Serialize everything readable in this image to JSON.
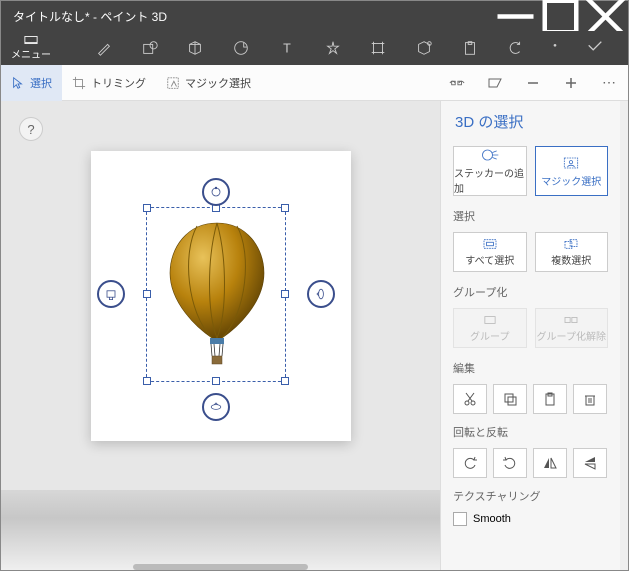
{
  "window": {
    "title": "タイトルなし* - ペイント 3D"
  },
  "menu": {
    "label": "メニュー"
  },
  "toolbar2": {
    "select": "選択",
    "trimming": "トリミング",
    "magicSelect": "マジック選択",
    "more": "⋯"
  },
  "help": "?",
  "panel": {
    "title": "3D の選択",
    "addSticker": "ステッカーの追加",
    "magicSelect": "マジック選択",
    "selectionLabel": "選択",
    "selectAll": "すべて選択",
    "multiSelect": "複数選択",
    "groupLabel": "グループ化",
    "group": "グループ",
    "ungroup": "グループ化解除",
    "editLabel": "編集",
    "rotateLabel": "回転と反転",
    "texturingLabel": "テクスチャリング",
    "smooth": "Smooth"
  }
}
